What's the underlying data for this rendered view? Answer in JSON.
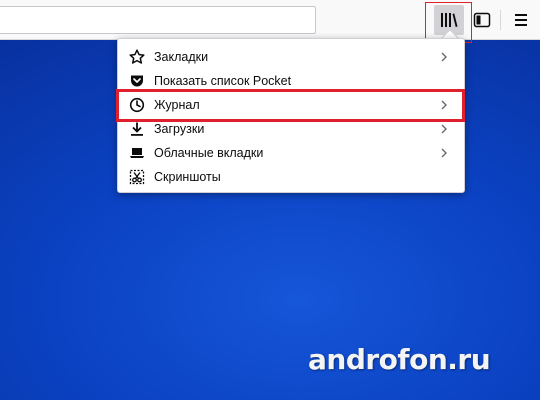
{
  "toolbar": {
    "url_value": "",
    "buttons": [
      {
        "name": "library",
        "icon": "library-icon"
      },
      {
        "name": "sidebar",
        "icon": "sidebar-icon"
      },
      {
        "name": "menu",
        "icon": "hamburger-menu-icon"
      }
    ]
  },
  "library_menu": {
    "items": [
      {
        "label": "Закладки",
        "icon": "star-icon",
        "has_submenu": true
      },
      {
        "label": "Показать список Pocket",
        "icon": "pocket-icon",
        "has_submenu": false
      },
      {
        "label": "Журнал",
        "icon": "clock-icon",
        "has_submenu": true,
        "highlighted": true
      },
      {
        "label": "Загрузки",
        "icon": "download-icon",
        "has_submenu": true
      },
      {
        "label": "Облачные вкладки",
        "icon": "synced-tabs-icon",
        "has_submenu": true
      },
      {
        "label": "Скриншоты",
        "icon": "screenshot-icon",
        "has_submenu": false
      }
    ]
  },
  "watermark": {
    "text": "androfon.ru"
  },
  "colors": {
    "desktop": "#0b43c4",
    "highlight": "#e0202c",
    "toolbar": "#f9f9fa"
  }
}
